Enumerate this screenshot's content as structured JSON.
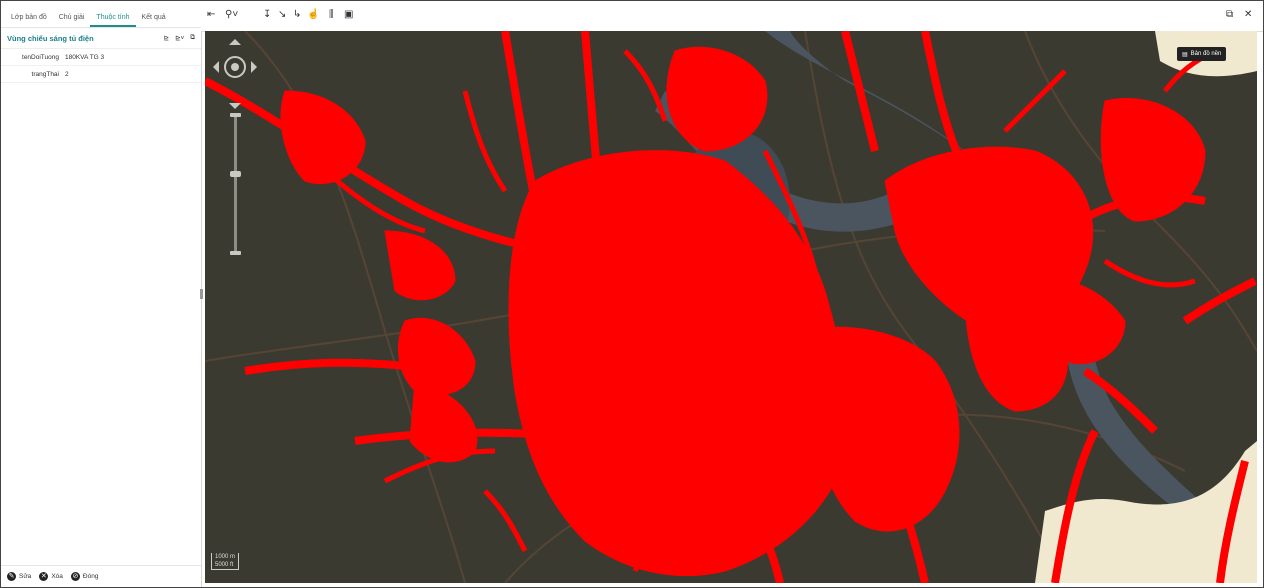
{
  "sidebar": {
    "tabs": [
      {
        "label": "Lớp bản đồ"
      },
      {
        "label": "Chú giải"
      },
      {
        "label": "Thuộc tính"
      },
      {
        "label": "Kết quả"
      }
    ],
    "layer_title": "Vùng chiếu sáng tủ điện",
    "attributes": [
      {
        "key": "tenDoiTuong",
        "value": "180KVA TG 3"
      },
      {
        "key": "trangThai",
        "value": "2"
      }
    ],
    "actions": [
      {
        "label": "Sửa",
        "icon": "edit-icon"
      },
      {
        "label": "Xóa",
        "icon": "delete-icon"
      },
      {
        "label": "Đóng",
        "icon": "close-icon"
      }
    ]
  },
  "map": {
    "basemap_label": "Bản đồ nền",
    "scale_text": "1000 m",
    "scale_text2": "5000 ft",
    "colors": {
      "background": "#3b3a31",
      "highlight": "#ff0000",
      "river": "#4a5560",
      "land": "#f1e9cf"
    }
  }
}
